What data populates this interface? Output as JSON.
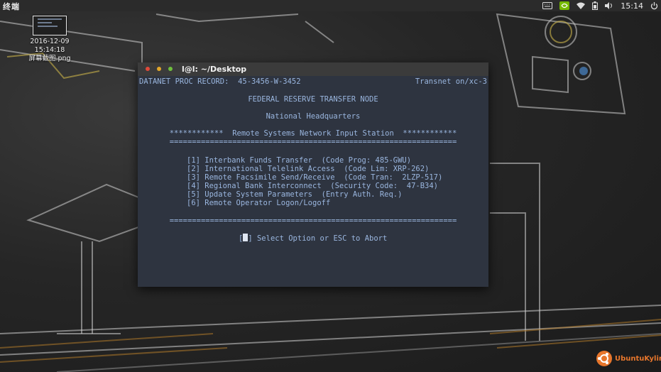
{
  "top_panel": {
    "app_name": "终端",
    "clock": "15:14",
    "indicators": [
      "keyboard-icon",
      "nvidia-icon",
      "wifi-icon",
      "battery-icon",
      "volume-icon",
      "power-icon"
    ]
  },
  "desktop": {
    "file_name_line1": "2016-12-09 15:14:18",
    "file_name_line2": "屏幕截图.png"
  },
  "terminal": {
    "title": "l@l: ~/Desktop",
    "header_left": "DATANET PROC RECORD:  45-3456-W-3452",
    "header_right": "Transnet on/xc-3",
    "line_node": "FEDERAL RESERVE TRANSFER NODE",
    "line_hq": "National Headquarters",
    "line_station": "************  Remote Systems Network Input Station  ************",
    "separator": "================================================================",
    "menu": [
      "[1] Interbank Funds Transfer  (Code Prog: 485-GWU)",
      "[2] International Telelink Access  (Code Lim: XRP-262)",
      "[3] Remote Facsimile Send/Receive  (Code Tran:  2LZP-517)",
      "[4] Regional Bank Interconnect  (Security Code:  47-B34)",
      "[5] Update System Parameters  (Entry Auth. Req.)",
      "[6] Remote Operator Logon/Logoff"
    ],
    "prompt_open": "[",
    "prompt_close": "]",
    "prompt_text": " Select Option or ESC to Abort"
  },
  "logo": {
    "text": "UbuntuKylin"
  },
  "colors": {
    "terminal_bg": "#2e3440",
    "terminal_text": "#9ab6df",
    "titlebar": "#3b3b3b",
    "logo": "#e7762c"
  }
}
